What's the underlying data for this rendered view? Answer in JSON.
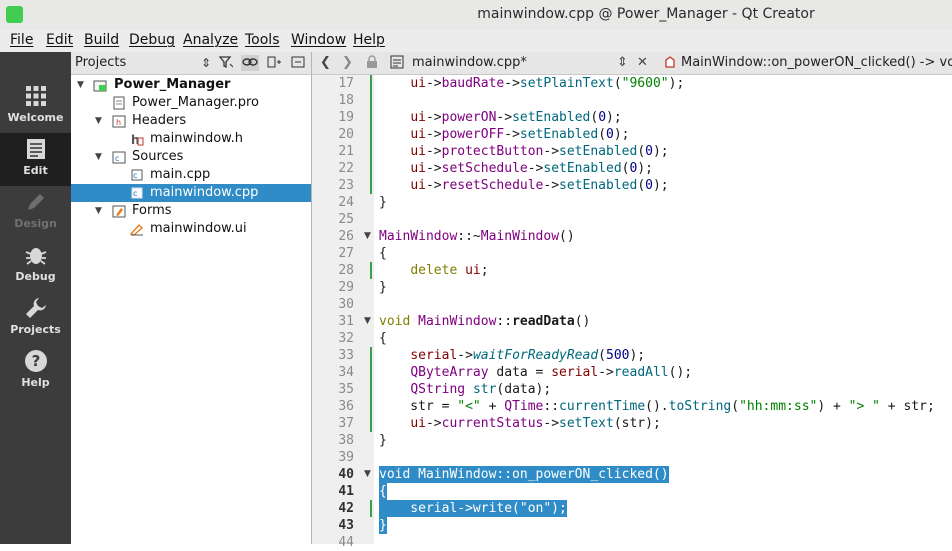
{
  "window": {
    "title": "mainwindow.cpp @ Power_Manager - Qt Creator",
    "logo_text": "Qt"
  },
  "menu": [
    "File",
    "Edit",
    "Build",
    "Debug",
    "Analyze",
    "Tools",
    "Window",
    "Help"
  ],
  "modes": [
    {
      "label": "Welcome",
      "icon": "grid-icon",
      "state": "normal"
    },
    {
      "label": "Edit",
      "icon": "document-icon",
      "state": "active"
    },
    {
      "label": "Design",
      "icon": "pen-icon",
      "state": "disabled"
    },
    {
      "label": "Debug",
      "icon": "bug-icon",
      "state": "normal"
    },
    {
      "label": "Projects",
      "icon": "wrench-icon",
      "state": "normal"
    },
    {
      "label": "Help",
      "icon": "question-icon",
      "state": "normal"
    }
  ],
  "projects_panel": {
    "selector": "Projects",
    "tree": [
      {
        "label": "Power_Manager",
        "level": 0,
        "expanded": true,
        "bold": true,
        "icon": "project-icon"
      },
      {
        "label": "Power_Manager.pro",
        "level": 1,
        "icon": "pro-file-icon"
      },
      {
        "label": "Headers",
        "level": 1,
        "expanded": true,
        "icon": "headers-folder-icon"
      },
      {
        "label": "mainwindow.h",
        "level": 2,
        "icon": "header-file-icon"
      },
      {
        "label": "Sources",
        "level": 1,
        "expanded": true,
        "icon": "sources-folder-icon"
      },
      {
        "label": "main.cpp",
        "level": 2,
        "icon": "cpp-file-icon"
      },
      {
        "label": "mainwindow.cpp",
        "level": 2,
        "icon": "cpp-file-icon",
        "selected": true
      },
      {
        "label": "Forms",
        "level": 1,
        "expanded": true,
        "icon": "forms-folder-icon"
      },
      {
        "label": "mainwindow.ui",
        "level": 2,
        "icon": "ui-file-icon"
      }
    ]
  },
  "editor": {
    "file_tab": "mainwindow.cpp*",
    "symbol": "MainWindow::on_powerON_clicked() -> void",
    "lines": [
      {
        "n": "17",
        "text": "    ui->baudRate->setPlainText(\"9600\");",
        "changed": true
      },
      {
        "n": "18",
        "text": "",
        "changed": true
      },
      {
        "n": "19",
        "text": "    ui->powerON->setEnabled(0);",
        "changed": true
      },
      {
        "n": "20",
        "text": "    ui->powerOFF->setEnabled(0);",
        "changed": true
      },
      {
        "n": "21",
        "text": "    ui->protectButton->setEnabled(0);",
        "changed": true
      },
      {
        "n": "22",
        "text": "    ui->setSchedule->setEnabled(0);",
        "changed": true
      },
      {
        "n": "23",
        "text": "    ui->resetSchedule->setEnabled(0);",
        "changed": true
      },
      {
        "n": "24",
        "text": "}"
      },
      {
        "n": "25",
        "text": ""
      },
      {
        "n": "26",
        "text": "MainWindow::~MainWindow()",
        "fold": true
      },
      {
        "n": "27",
        "text": "{"
      },
      {
        "n": "28",
        "text": "    delete ui;",
        "changed": true
      },
      {
        "n": "29",
        "text": "}"
      },
      {
        "n": "30",
        "text": ""
      },
      {
        "n": "31",
        "text": "void MainWindow::readData()",
        "fold": true
      },
      {
        "n": "32",
        "text": "{"
      },
      {
        "n": "33",
        "text": "    serial->waitForReadyRead(500);",
        "changed": true
      },
      {
        "n": "34",
        "text": "    QByteArray data = serial->readAll();",
        "changed": true
      },
      {
        "n": "35",
        "text": "    QString str(data);",
        "changed": true
      },
      {
        "n": "36",
        "text": "    str = \"<\" + QTime::currentTime().toString(\"hh:mm:ss\") + \"> \" + str;",
        "changed": true
      },
      {
        "n": "37",
        "text": "    ui->currentStatus->setText(str);",
        "changed": true
      },
      {
        "n": "38",
        "text": "}"
      },
      {
        "n": "39",
        "text": ""
      },
      {
        "n": "40",
        "text": "void MainWindow::on_powerON_clicked()",
        "fold": true,
        "selected": true,
        "current": true
      },
      {
        "n": "41",
        "text": "{",
        "selected": true,
        "current": true
      },
      {
        "n": "42",
        "text": "    serial->write(\"on\");",
        "selected": true,
        "current": true,
        "changed": true
      },
      {
        "n": "43",
        "text": "}",
        "selected": true,
        "current": true
      },
      {
        "n": "44",
        "text": ""
      }
    ]
  }
}
